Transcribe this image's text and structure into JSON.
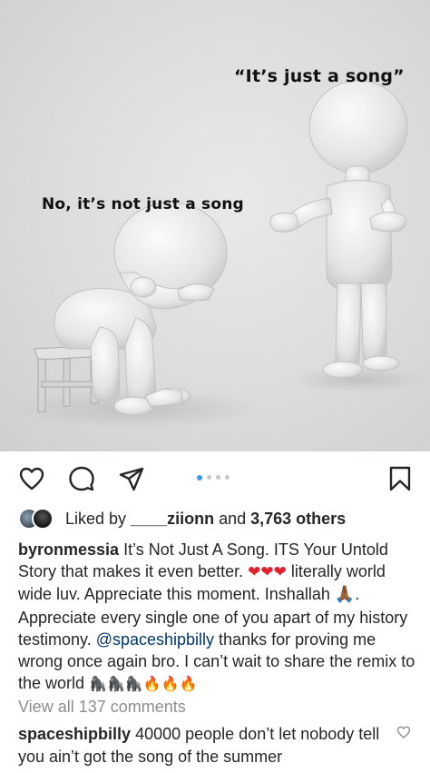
{
  "meme": {
    "caption_right": "“It’s just a song”",
    "caption_left": "No, it’s not just a song"
  },
  "carousel": {
    "total": 4,
    "active_index": 0
  },
  "likes": {
    "prefix": "Liked by ",
    "user": "____ziionn",
    "middle": " and ",
    "count": "3,763 others"
  },
  "caption": {
    "username": "byronmessia",
    "part1": " It’s Not Just A Song. ITS Your Untold Story that makes it even better. ",
    "hearts": "❤❤❤",
    "part2": " literally world wide luv. Appreciate this moment. Inshallah ",
    "hands": "🙏🏾",
    "part3": ". Appreciate every single one of you apart of my history testimony.  ",
    "mention": "@spaceshipbilly",
    "part4": " thanks for proving me wrong once again bro. I can’t wait to share the remix to the world ",
    "gorillas": "🦍🦍🦍",
    "fires": "🔥🔥🔥"
  },
  "view_comments": "View all 137 comments",
  "comment": {
    "username": "spaceshipbilly",
    "text": " 40000 people don’t let nobody tell you ain’t got the song of the summer"
  },
  "colors": {
    "link": "#00376b",
    "accent": "#3897f0",
    "muted": "#8e8e8e",
    "heart": "#e0202d"
  },
  "icons": [
    "heart-icon",
    "comment-icon",
    "share-icon",
    "bookmark-icon"
  ]
}
